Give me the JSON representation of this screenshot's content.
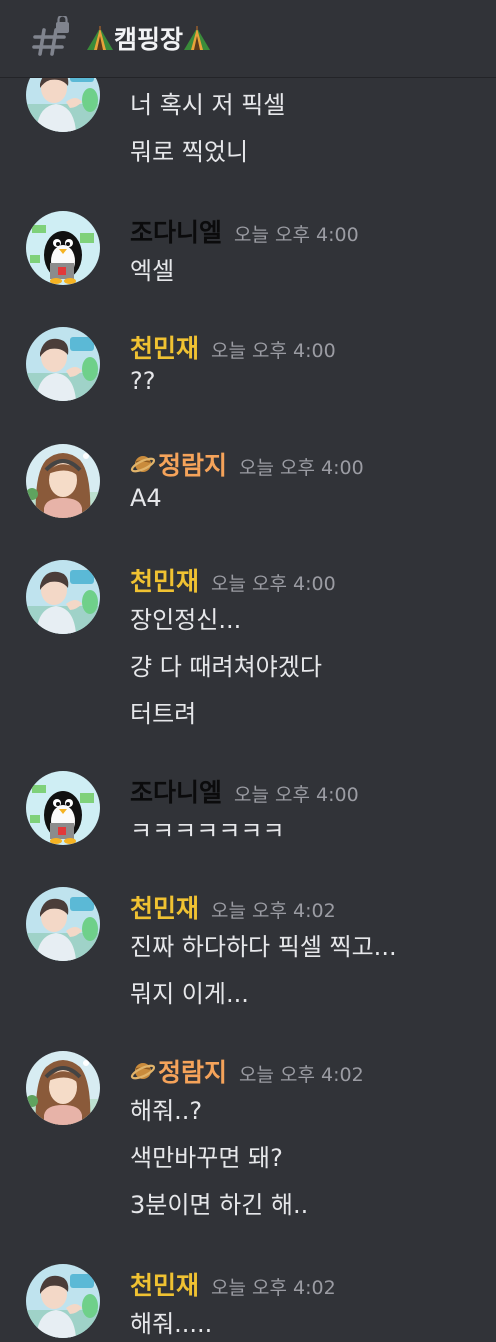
{
  "header": {
    "channel_name": "캠핑장"
  },
  "groups": [
    {
      "author": "",
      "timestamp": "",
      "messages": [
        "너 혹시 저 픽셀",
        "뭐로 찍었니"
      ]
    },
    {
      "author": "조다니엘",
      "timestamp": "오늘 오후 4:00",
      "messages": [
        "엑셀"
      ]
    },
    {
      "author": "천민재",
      "timestamp": "오늘 오후 4:00",
      "messages": [
        "??"
      ]
    },
    {
      "author": "정람지",
      "timestamp": "오늘 오후 4:00",
      "messages": [
        "A4"
      ]
    },
    {
      "author": "천민재",
      "timestamp": "오늘 오후 4:00",
      "messages": [
        "장인정신...",
        "걍 다 때려쳐야겠다",
        "터트려"
      ]
    },
    {
      "author": "조다니엘",
      "timestamp": "오늘 오후 4:00",
      "messages": [
        "ㅋㅋㅋㅋㅋㅋㅋ"
      ]
    },
    {
      "author": "천민재",
      "timestamp": "오늘 오후 4:02",
      "messages": [
        "진짜 하다하다 픽셀 찍고...",
        "뭐지 이게..."
      ]
    },
    {
      "author": "정람지",
      "timestamp": "오늘 오후 4:02",
      "messages": [
        "해줘..?",
        "색만바꾸면 돼?",
        "3분이면 하긴 해.."
      ]
    },
    {
      "author": "천민재",
      "timestamp": "오늘 오후 4:02",
      "messages": [
        "해줘....."
      ]
    }
  ],
  "colors": {
    "background": "#313338",
    "username_minjae": "#f0c232",
    "username_ramji": "#f5a35a",
    "username_daniel": "#0b0b0c",
    "timestamp": "#9b9ca3",
    "message_text": "#e6e7ea"
  },
  "icons": [
    "hashtag-lock-icon",
    "tent-icon",
    "planet-icon",
    "avatar-minjae",
    "avatar-daniel-penguin",
    "avatar-ramji"
  ]
}
